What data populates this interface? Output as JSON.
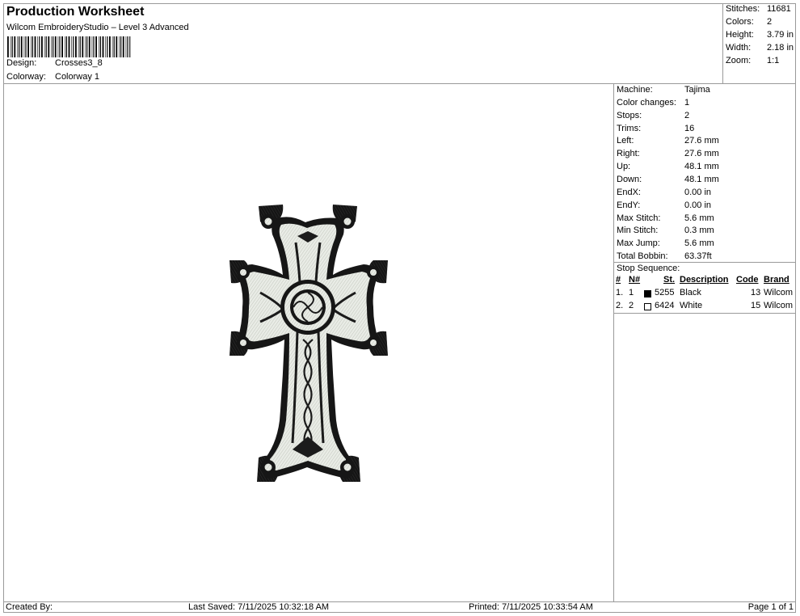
{
  "header": {
    "title": "Production Worksheet",
    "subtitle": "Wilcom EmbroideryStudio – Level 3 Advanced",
    "design_label": "Design:",
    "design_value": "Crosses3_8",
    "colorway_label": "Colorway:",
    "colorway_value": "Colorway 1"
  },
  "summary": [
    {
      "label": "Stitches:",
      "value": "11681"
    },
    {
      "label": "Colors:",
      "value": "2"
    },
    {
      "label": "Height:",
      "value": "3.79 in"
    },
    {
      "label": "Width:",
      "value": "2.18 in"
    },
    {
      "label": "Zoom:",
      "value": "1:1"
    }
  ],
  "machine_info": [
    {
      "label": "Machine:",
      "value": "Tajima"
    },
    {
      "label": "Color changes:",
      "value": "1"
    },
    {
      "label": "Stops:",
      "value": "2"
    },
    {
      "label": "Trims:",
      "value": "16"
    },
    {
      "label": "Left:",
      "value": "27.6 mm"
    },
    {
      "label": "Right:",
      "value": "27.6 mm"
    },
    {
      "label": "Up:",
      "value": "48.1 mm"
    },
    {
      "label": "Down:",
      "value": "48.1 mm"
    },
    {
      "label": "EndX:",
      "value": "0.00 in"
    },
    {
      "label": "EndY:",
      "value": "0.00 in"
    },
    {
      "label": "Max Stitch:",
      "value": "5.6 mm"
    },
    {
      "label": "Min Stitch:",
      "value": "0.3 mm"
    },
    {
      "label": "Max Jump:",
      "value": "5.6 mm"
    },
    {
      "label": "Total Bobbin:",
      "value": "63.37ft"
    }
  ],
  "stop_sequence": {
    "label": "Stop Sequence:",
    "columns": [
      "#",
      "N#",
      "St.",
      "Description",
      "Code",
      "Brand"
    ],
    "rows": [
      {
        "index": "1.",
        "n": "1",
        "color": "#000000",
        "st": "5255",
        "description": "Black",
        "code": "13",
        "brand": "Wilcom"
      },
      {
        "index": "2.",
        "n": "2",
        "color": "#ffffff",
        "st": "6424",
        "description": "White",
        "code": "15",
        "brand": "Wilcom"
      }
    ]
  },
  "footer": {
    "created_by": "Created By:",
    "last_saved": "Last Saved: 7/11/2025 10:32:18 AM",
    "printed": "Printed: 7/11/2025 10:33:54 AM",
    "page": "Page 1 of 1"
  },
  "colors": {
    "border": "#9a9a9a",
    "thread_black": "#111111",
    "thread_white": "#e9ece6"
  }
}
